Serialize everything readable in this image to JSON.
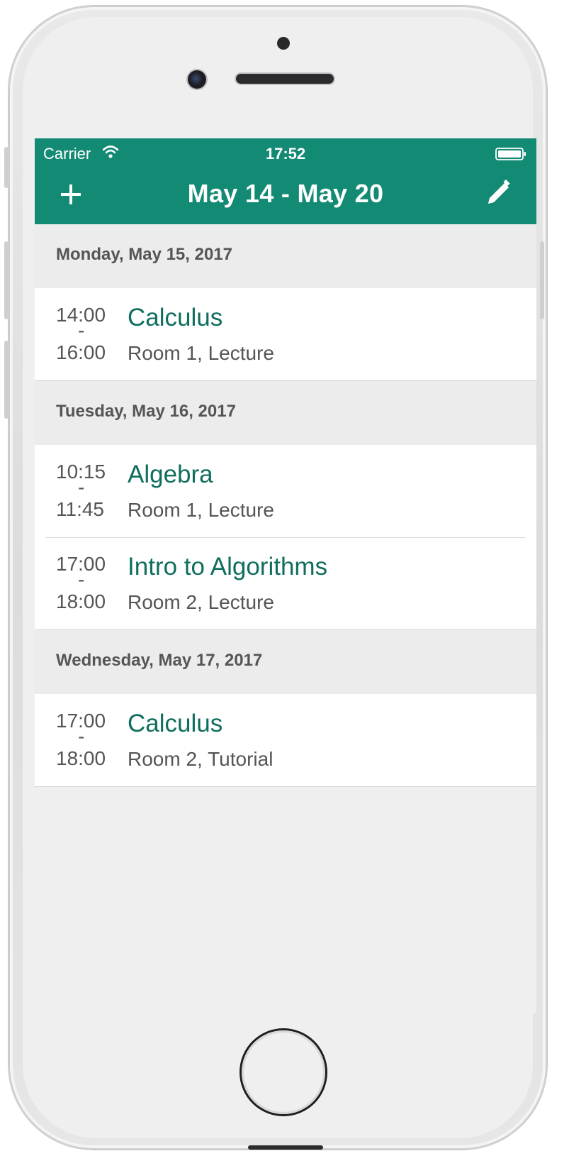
{
  "status_bar": {
    "carrier": "Carrier",
    "time": "17:52",
    "wifi_icon": "wifi-icon",
    "battery_icon": "battery-icon"
  },
  "navbar": {
    "title": "May 14 - May 20",
    "add_icon": "plus-icon",
    "edit_icon": "pencil-icon",
    "color": "#128a74"
  },
  "days": [
    {
      "header": "Monday, May 15, 2017",
      "events": [
        {
          "start": "14:00",
          "dash": "-",
          "end": "16:00",
          "course": "Calculus",
          "location": "Room 1, Lecture"
        }
      ]
    },
    {
      "header": "Tuesday, May 16, 2017",
      "events": [
        {
          "start": "10:15",
          "dash": "-",
          "end": "11:45",
          "course": "Algebra",
          "location": "Room 1, Lecture"
        },
        {
          "start": "17:00",
          "dash": "-",
          "end": "18:00",
          "course": "Intro to Algorithms",
          "location": "Room 2, Lecture"
        }
      ]
    },
    {
      "header": "Wednesday, May 17, 2017",
      "events": [
        {
          "start": "17:00",
          "dash": "-",
          "end": "18:00",
          "course": "Calculus",
          "location": "Room 2, Tutorial"
        }
      ]
    }
  ],
  "colors": {
    "course_text": "#0f6e5d",
    "secondary_text": "#555555",
    "section_background": "#ececed"
  }
}
